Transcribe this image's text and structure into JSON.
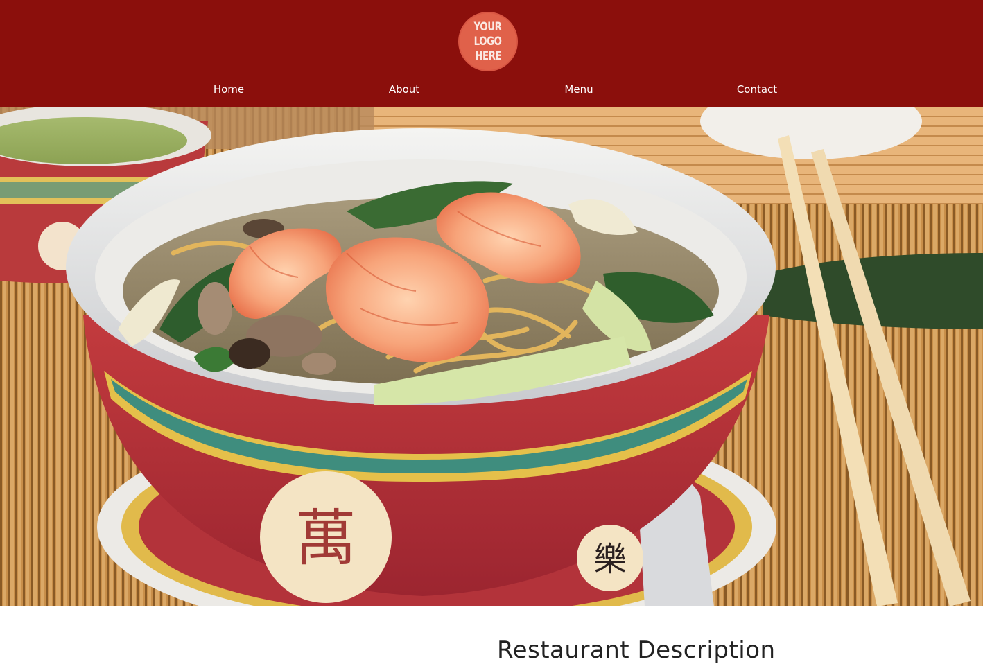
{
  "header": {
    "background_color": "#8b0f0c",
    "logo": {
      "lines": [
        "YOUR",
        "LOGO",
        "HERE"
      ],
      "color": "#e0614a"
    },
    "nav": [
      {
        "label": "Home"
      },
      {
        "label": "About"
      },
      {
        "label": "Menu"
      },
      {
        "label": "Contact"
      }
    ]
  },
  "hero": {
    "image_description_name": "noodle-soup-photo",
    "bowl_character": "萬",
    "saucer_character": "樂"
  },
  "main": {
    "section_title": "Restaurant Description"
  }
}
